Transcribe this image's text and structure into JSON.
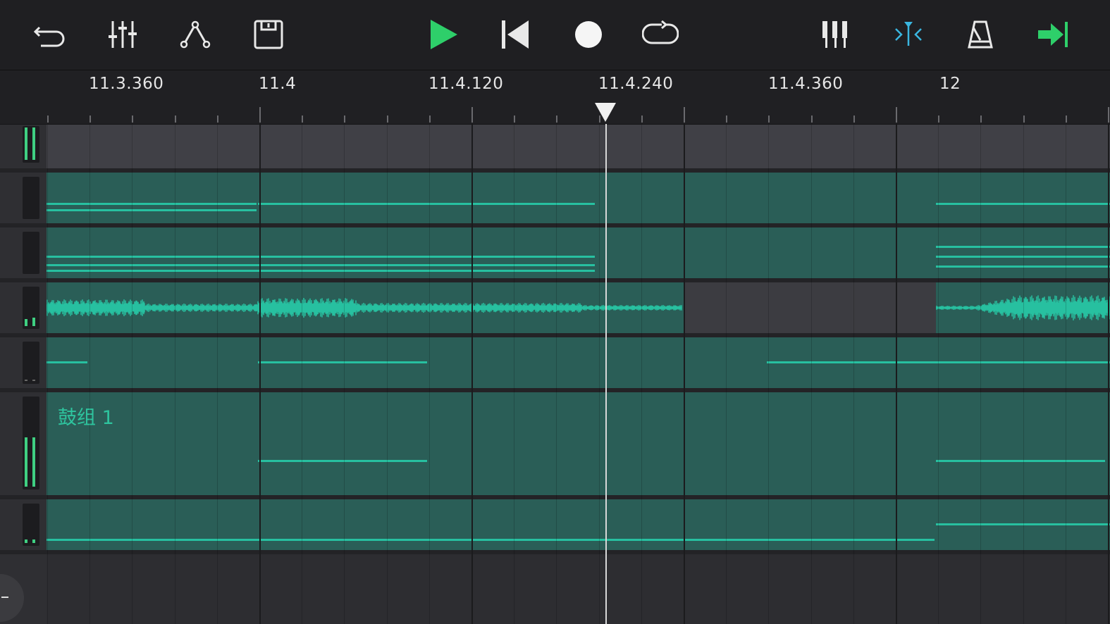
{
  "toolbar": {
    "buttons": [
      "undo-icon",
      "mixer-icon",
      "automation-icon",
      "save-icon",
      "play-icon",
      "rewind-icon",
      "record-icon",
      "loop-icon",
      "piano-icon",
      "snap-icon",
      "metronome-icon",
      "end-icon"
    ],
    "colors": {
      "play": "#2ecf6a",
      "snap": "#3ab6e0",
      "end": "#2ecf6a",
      "icon": "#e8e8e8"
    }
  },
  "ruler": {
    "labels": [
      "11.3.360",
      "11.4",
      "11.4.120",
      "11.4.240",
      "11.4.360",
      "12"
    ]
  },
  "tracks": {
    "drum_name": "鼓组 1"
  },
  "colors": {
    "clip": "#2a5e57",
    "note": "#27c0a0",
    "meter": "#3fd082",
    "background": "#2d2d31"
  }
}
